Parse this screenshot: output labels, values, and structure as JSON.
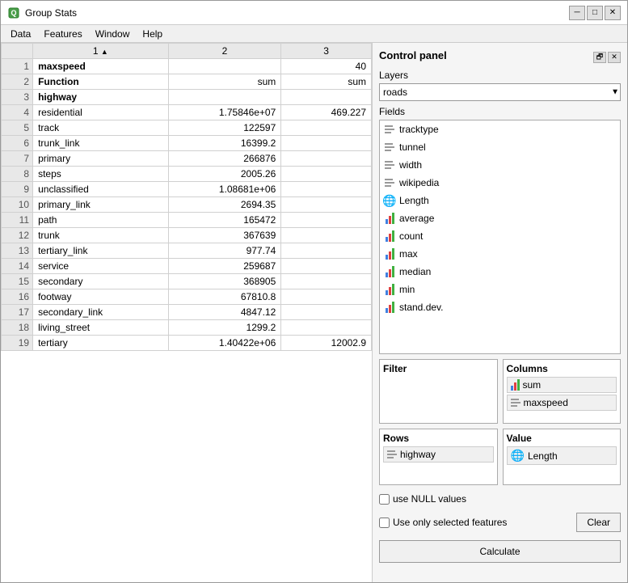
{
  "window": {
    "title": "Group Stats",
    "icon": "Q"
  },
  "menu": {
    "items": [
      "Data",
      "Features",
      "Window",
      "Help"
    ]
  },
  "table": {
    "headers": [
      "1",
      "2",
      "3"
    ],
    "col1_label": "maxspeed",
    "col2_label": "Function",
    "col3_header_val": "40",
    "col2_row2": "sum",
    "col3_row2": "sum",
    "row2_label": "highway",
    "rows": [
      {
        "id": "3",
        "col1": "highway",
        "col2": "",
        "col3": "",
        "bold": true
      },
      {
        "id": "4",
        "col1": "residential",
        "col2": "1.75846e+07",
        "col3": "469.227"
      },
      {
        "id": "5",
        "col1": "track",
        "col2": "122597",
        "col3": ""
      },
      {
        "id": "6",
        "col1": "trunk_link",
        "col2": "16399.2",
        "col3": ""
      },
      {
        "id": "7",
        "col1": "primary",
        "col2": "266876",
        "col3": ""
      },
      {
        "id": "8",
        "col1": "steps",
        "col2": "2005.26",
        "col3": ""
      },
      {
        "id": "9",
        "col1": "unclassified",
        "col2": "1.08681e+06",
        "col3": ""
      },
      {
        "id": "10",
        "col1": "primary_link",
        "col2": "2694.35",
        "col3": ""
      },
      {
        "id": "11",
        "col1": "path",
        "col2": "165472",
        "col3": ""
      },
      {
        "id": "12",
        "col1": "trunk",
        "col2": "367639",
        "col3": ""
      },
      {
        "id": "13",
        "col1": "tertiary_link",
        "col2": "977.74",
        "col3": ""
      },
      {
        "id": "14",
        "col1": "service",
        "col2": "259687",
        "col3": ""
      },
      {
        "id": "15",
        "col1": "secondary",
        "col2": "368905",
        "col3": ""
      },
      {
        "id": "16",
        "col1": "footway",
        "col2": "67810.8",
        "col3": ""
      },
      {
        "id": "17",
        "col1": "secondary_link",
        "col2": "4847.12",
        "col3": ""
      },
      {
        "id": "18",
        "col1": "living_street",
        "col2": "1299.2",
        "col3": ""
      },
      {
        "id": "19",
        "col1": "tertiary",
        "col2": "1.40422e+06",
        "col3": "12002.9"
      }
    ]
  },
  "control_panel": {
    "title": "Control panel",
    "layers_label": "Layers",
    "layers_value": "roads",
    "fields_label": "Fields",
    "fields": [
      {
        "name": "tracktype",
        "type": "text"
      },
      {
        "name": "tunnel",
        "type": "text"
      },
      {
        "name": "width",
        "type": "text"
      },
      {
        "name": "wikipedia",
        "type": "text"
      },
      {
        "name": "Length",
        "type": "globe"
      },
      {
        "name": "average",
        "type": "bar"
      },
      {
        "name": "count",
        "type": "bar"
      },
      {
        "name": "max",
        "type": "bar"
      },
      {
        "name": "median",
        "type": "bar"
      },
      {
        "name": "min",
        "type": "bar"
      },
      {
        "name": "stand.dev.",
        "type": "bar"
      }
    ],
    "filter_label": "Filter",
    "columns_label": "Columns",
    "columns_items": [
      {
        "name": "sum",
        "type": "bar"
      },
      {
        "name": "maxspeed",
        "type": "text"
      }
    ],
    "rows_label": "Rows",
    "rows_items": [
      {
        "name": "highway",
        "type": "text"
      }
    ],
    "value_label": "Value",
    "value_items": [
      {
        "name": "Length",
        "type": "globe"
      }
    ],
    "use_null_label": "use NULL values",
    "use_selected_label": "Use only selected features",
    "clear_label": "Clear",
    "calculate_label": "Calculate"
  }
}
